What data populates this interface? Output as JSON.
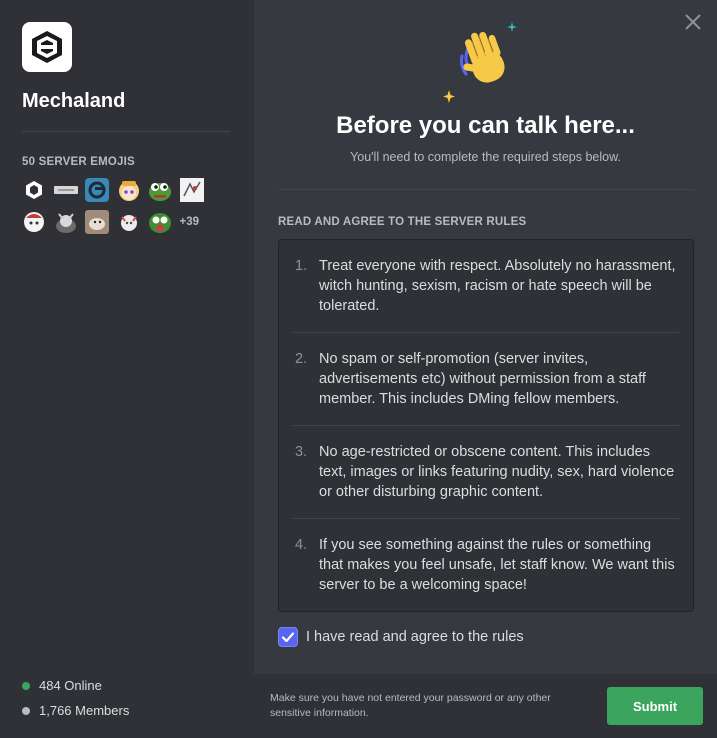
{
  "server": {
    "name": "Mechaland",
    "icon": "mechaland-logo-icon"
  },
  "emojis": {
    "title": "50 SERVER EMOJIS",
    "items": [
      "mecha-logo-emoji",
      "banner-emoji",
      "teal-badge-emoji",
      "anime-girl-emoji",
      "pepe-emoji",
      "anime-sketch-emoji",
      "chibi-emoji",
      "creature-emoji",
      "dog-emoji",
      "chibi-cat-emoji",
      "pepe-mad-emoji"
    ],
    "more": "+39"
  },
  "stats": {
    "online": "484 Online",
    "members": "1,766 Members",
    "online_color": "#3ba55d",
    "members_color": "#b9bbbe"
  },
  "header": {
    "title": "Before you can talk here...",
    "subtitle": "You'll need to complete the required steps below."
  },
  "rules": {
    "title": "READ AND AGREE TO THE SERVER RULES",
    "items": [
      {
        "num": "1.",
        "text": "Treat everyone with respect. Absolutely no harassment, witch hunting, sexism, racism or hate speech will be tolerated."
      },
      {
        "num": "2.",
        "text": "No spam or self-promotion (server invites, advertisements etc) without permission from a staff member. This includes DMing fellow members."
      },
      {
        "num": "3.",
        "text": "No age-restricted or obscene content. This includes text, images or links featuring nudity, sex, hard violence or other disturbing graphic content."
      },
      {
        "num": "4.",
        "text": "If you see something against the rules or something that makes you feel unsafe, let staff know. We want this server to be a welcoming space!"
      }
    ]
  },
  "agree": {
    "label": "I have read and agree to the rules",
    "checked": true
  },
  "footer": {
    "note": "Make sure you have not entered your password or any other sensitive information.",
    "submit_label": "Submit",
    "submit_color": "#3ba55d"
  },
  "colors": {
    "accent": "#5865f2",
    "sidebar_bg": "#2f3136",
    "main_bg": "#36393f"
  }
}
